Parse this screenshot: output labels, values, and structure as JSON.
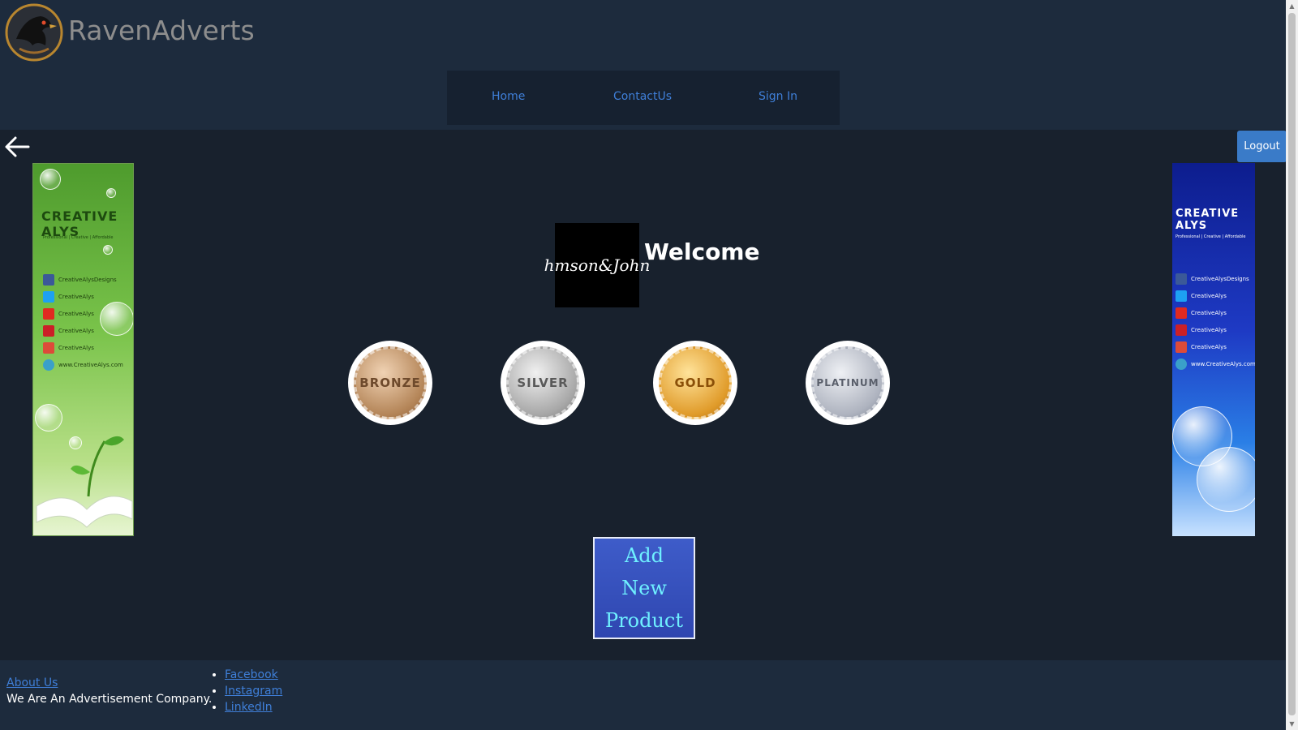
{
  "header": {
    "brand": "RavenAdverts",
    "nav": [
      {
        "label": "Home"
      },
      {
        "label": "ContactUs"
      },
      {
        "label": "Sign In"
      }
    ]
  },
  "actions": {
    "logout_label": "Logout"
  },
  "ads": {
    "left": {
      "brand": "CREATIVE ALYS",
      "tagline": "Professional | Creative | Affordable",
      "items": [
        "CreativeAlysDesigns",
        "CreativeAlys",
        "CreativeAlys",
        "CreativeAlys",
        "CreativeAlys",
        "www.CreativeAlys.com"
      ]
    },
    "right": {
      "brand": "CREATIVE ALYS",
      "tagline": "Professional | Creative | Affordable",
      "items": [
        "CreativeAlysDesigns",
        "CreativeAlys",
        "CreativeAlys",
        "CreativeAlys",
        "CreativeAlys",
        "www.CreativeAlys.com"
      ]
    }
  },
  "main": {
    "brand_logo_text": "hmson&John",
    "welcome": "Welcome",
    "tiers": [
      {
        "label": "BRONZE"
      },
      {
        "label": "SILVER"
      },
      {
        "label": "GOLD"
      },
      {
        "label": "PLATINUM"
      }
    ],
    "add_product_label": "Add\nNew\nProduct"
  },
  "footer": {
    "about_label": "About Us",
    "tagline": "We Are An Advertisement Company.",
    "social": [
      {
        "label": "Facebook"
      },
      {
        "label": "Instagram"
      },
      {
        "label": "LinkedIn"
      }
    ]
  },
  "colors": {
    "page_bg": "#18212d",
    "header_bg": "#1d2b3d",
    "link": "#3f7fd8",
    "logout_bg": "#3a7bc8",
    "add_product_text": "#6ff0ff"
  },
  "icons": {
    "back": "arrow-left-icon",
    "logo": "raven-logo-icon"
  }
}
